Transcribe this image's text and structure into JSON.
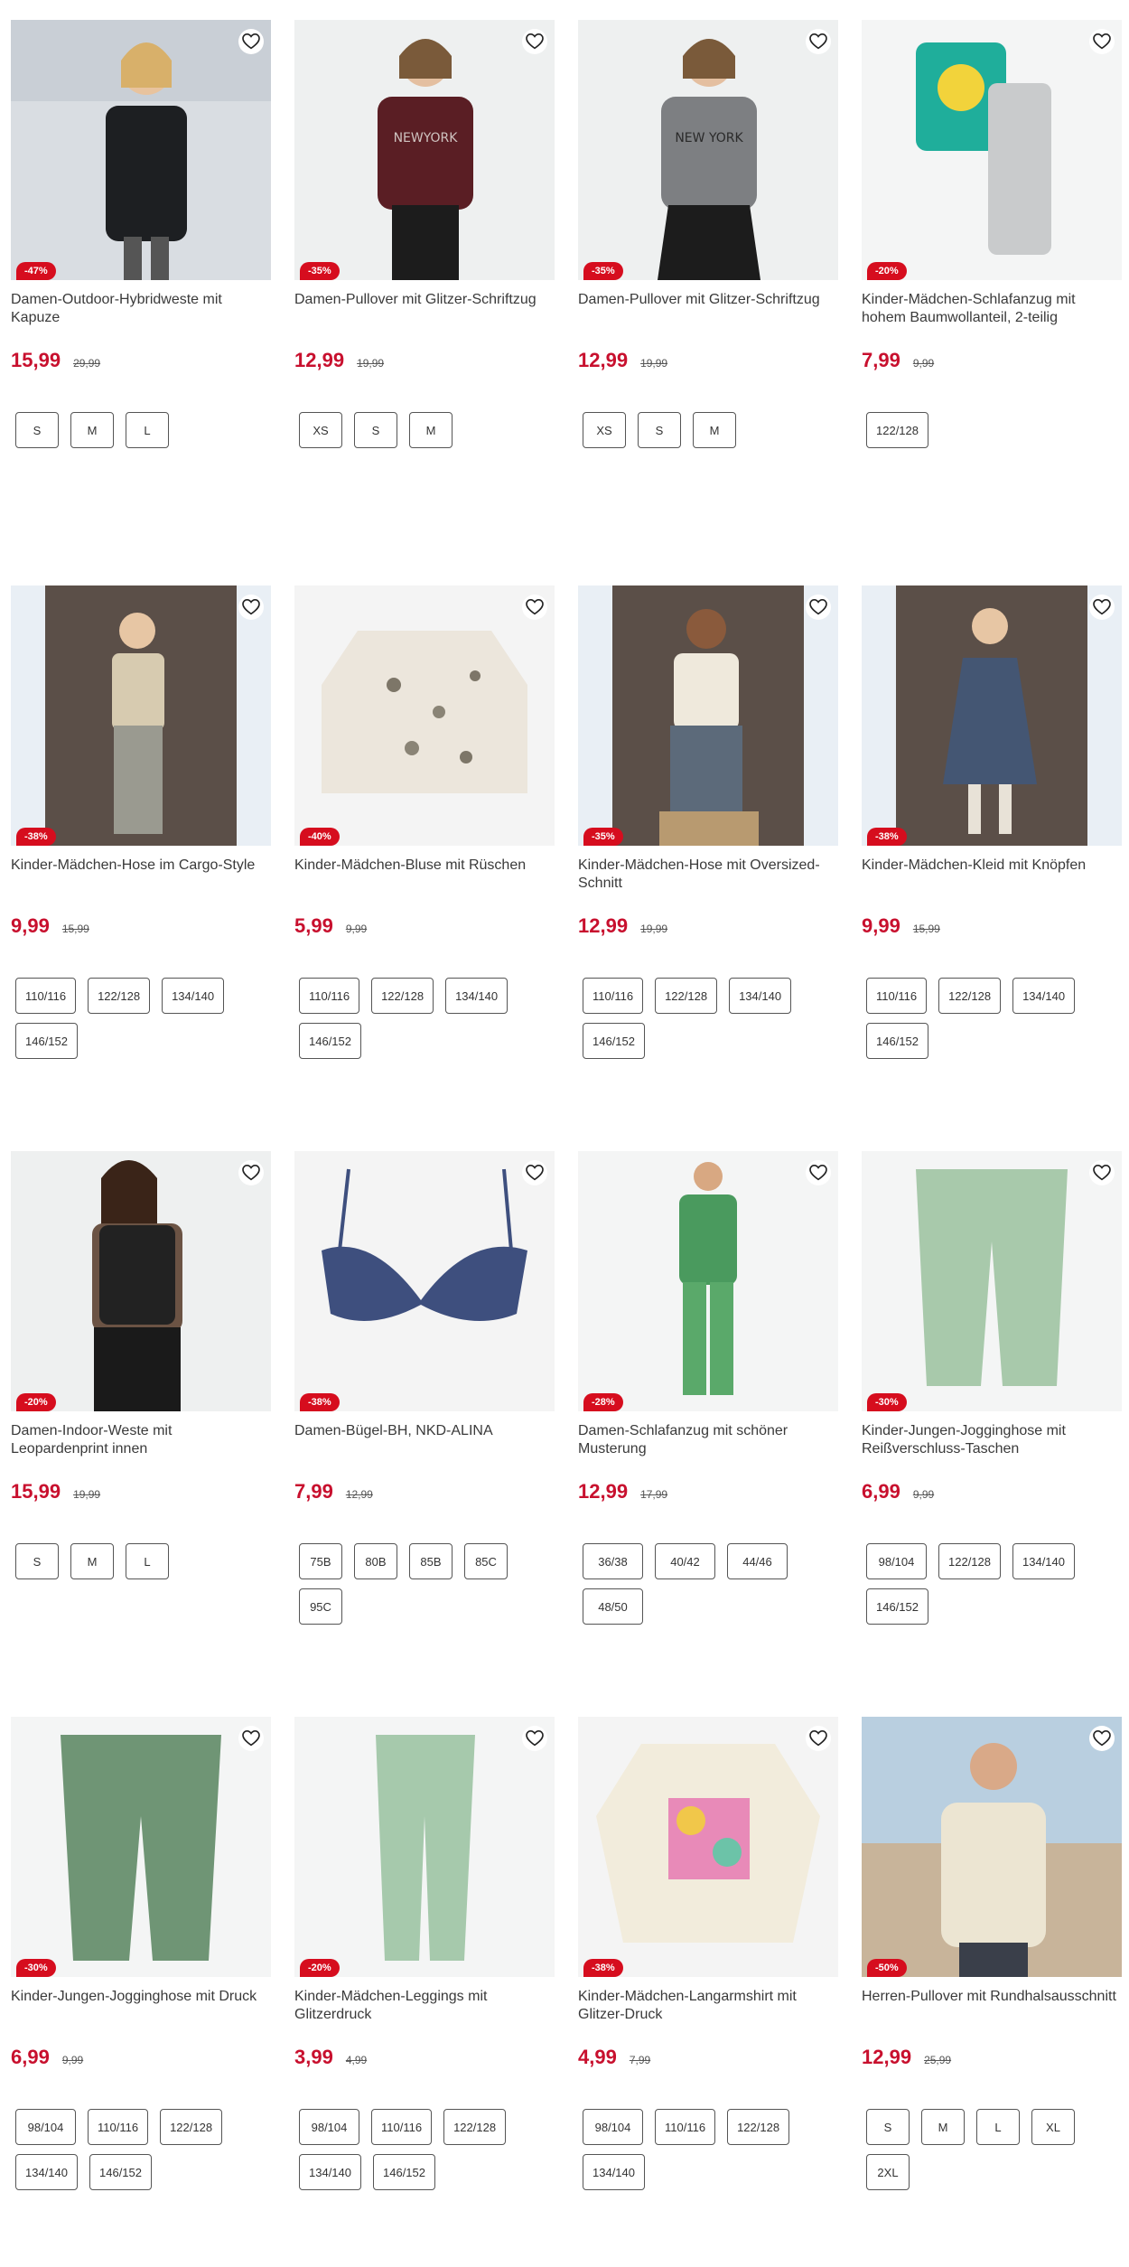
{
  "colors": {
    "price": "#c8102e",
    "badge": "#d60d1e",
    "image_bg": "#f1f2f2"
  },
  "products": [
    {
      "title": "Damen-Outdoor-Hybridweste mit Kapuze",
      "discount": "-47%",
      "price": "15,99",
      "old_price": "29,99",
      "sizes": [
        "S",
        "M",
        "L"
      ],
      "image": "woman-black-vest-photo"
    },
    {
      "title": "Damen-Pullover mit Glitzer-Schriftzug",
      "discount": "-35%",
      "price": "12,99",
      "old_price": "19,99",
      "sizes": [
        "XS",
        "S",
        "M"
      ],
      "image": "woman-burgundy-sweater-photo"
    },
    {
      "title": "Damen-Pullover mit Glitzer-Schriftzug",
      "discount": "-35%",
      "price": "12,99",
      "old_price": "19,99",
      "sizes": [
        "XS",
        "S",
        "M"
      ],
      "image": "woman-grey-sweater-photo"
    },
    {
      "title": "Kinder-Mädchen-Schlafanzug mit hohem Baumwollanteil, 2-teilig",
      "discount": "-20%",
      "price": "7,99",
      "old_price": "9,99",
      "sizes": [
        "122/128"
      ],
      "image": "kids-pajama-smiley-photo"
    },
    {
      "title": "Kinder-Mädchen-Hose im Cargo-Style",
      "discount": "-38%",
      "price": "9,99",
      "old_price": "15,99",
      "sizes": [
        "110/116",
        "122/128",
        "134/140",
        "146/152"
      ],
      "image": "girl-cargo-pants-photo"
    },
    {
      "title": "Kinder-Mädchen-Bluse mit Rüschen",
      "discount": "-40%",
      "price": "5,99",
      "old_price": "9,99",
      "sizes": [
        "110/116",
        "122/128",
        "134/140",
        "146/152"
      ],
      "image": "floral-blouse-photo"
    },
    {
      "title": "Kinder-Mädchen-Hose mit Oversized-Schnitt",
      "discount": "-35%",
      "price": "12,99",
      "old_price": "19,99",
      "sizes": [
        "110/116",
        "122/128",
        "134/140",
        "146/152"
      ],
      "image": "girl-oversized-pants-photo"
    },
    {
      "title": "Kinder-Mädchen-Kleid mit Knöpfen",
      "discount": "-38%",
      "price": "9,99",
      "old_price": "15,99",
      "sizes": [
        "110/116",
        "122/128",
        "134/140",
        "146/152"
      ],
      "image": "girl-denim-dress-photo"
    },
    {
      "title": "Damen-Indoor-Weste mit Leopardenprint innen",
      "discount": "-20%",
      "price": "15,99",
      "old_price": "19,99",
      "sizes": [
        "S",
        "M",
        "L"
      ],
      "image": "woman-indoor-vest-photo"
    },
    {
      "title": "Damen-Bügel-BH, NKD-ALINA",
      "discount": "-38%",
      "price": "7,99",
      "old_price": "12,99",
      "sizes": [
        "75B",
        "80B",
        "85B",
        "85C",
        "95C"
      ],
      "image": "blue-bra-photo"
    },
    {
      "title": "Damen-Schlafanzug mit schöner Musterung",
      "discount": "-28%",
      "price": "12,99",
      "old_price": "17,99",
      "sizes": [
        "36/38",
        "40/42",
        "44/46",
        "48/50"
      ],
      "image": "woman-green-pajama-photo"
    },
    {
      "title": "Kinder-Jungen-Jogginghose mit Reißverschluss-Taschen",
      "discount": "-30%",
      "price": "6,99",
      "old_price": "9,99",
      "sizes": [
        "98/104",
        "122/128",
        "134/140",
        "146/152"
      ],
      "image": "green-joggers-photo"
    },
    {
      "title": "Kinder-Jungen-Jogginghose mit Druck",
      "discount": "-30%",
      "price": "6,99",
      "old_price": "9,99",
      "sizes": [
        "98/104",
        "110/116",
        "122/128",
        "134/140",
        "146/152"
      ],
      "image": "green-print-joggers-photo"
    },
    {
      "title": "Kinder-Mädchen-Leggings mit Glitzerdruck",
      "discount": "-20%",
      "price": "3,99",
      "old_price": "4,99",
      "sizes": [
        "98/104",
        "110/116",
        "122/128",
        "134/140",
        "146/152"
      ],
      "image": "green-leggings-photo"
    },
    {
      "title": "Kinder-Mädchen-Langarmshirt mit Glitzer-Druck",
      "discount": "-38%",
      "price": "4,99",
      "old_price": "7,99",
      "sizes": [
        "98/104",
        "110/116",
        "122/128",
        "134/140"
      ],
      "image": "magical-longsleeve-photo"
    },
    {
      "title": "Herren-Pullover mit Rundhalsausschnitt",
      "discount": "-50%",
      "price": "12,99",
      "old_price": "25,99",
      "sizes": [
        "S",
        "M",
        "L",
        "XL",
        "2XL"
      ],
      "image": "man-cream-sweater-photo"
    }
  ]
}
